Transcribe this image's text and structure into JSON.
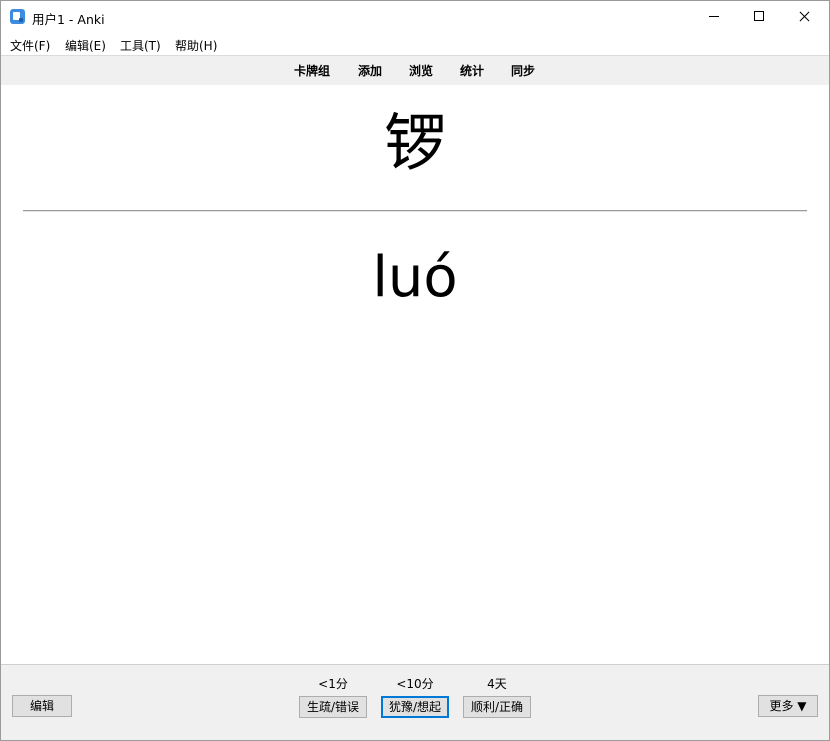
{
  "window": {
    "title": "用户1 - Anki"
  },
  "menu": {
    "items": [
      {
        "label": "文件(F)"
      },
      {
        "label": "编辑(E)"
      },
      {
        "label": "工具(T)"
      },
      {
        "label": "帮助(H)"
      }
    ]
  },
  "toolbar": {
    "links": [
      {
        "label": "卡牌组"
      },
      {
        "label": "添加"
      },
      {
        "label": "浏览"
      },
      {
        "label": "统计"
      },
      {
        "label": "同步"
      }
    ]
  },
  "card": {
    "front": "锣",
    "back": "luó"
  },
  "bottom": {
    "edit_label": "编辑",
    "more_label": "更多 ▼",
    "answers": [
      {
        "interval": "<1分",
        "label": "生疏/错误"
      },
      {
        "interval": "<10分",
        "label": "犹豫/想起"
      },
      {
        "interval": "4天",
        "label": "顺利/正确"
      }
    ]
  },
  "colors": {
    "focus_border": "#0078d7",
    "toolbar_bg": "#f0f0f0",
    "app_icon": "#3c8de0"
  }
}
